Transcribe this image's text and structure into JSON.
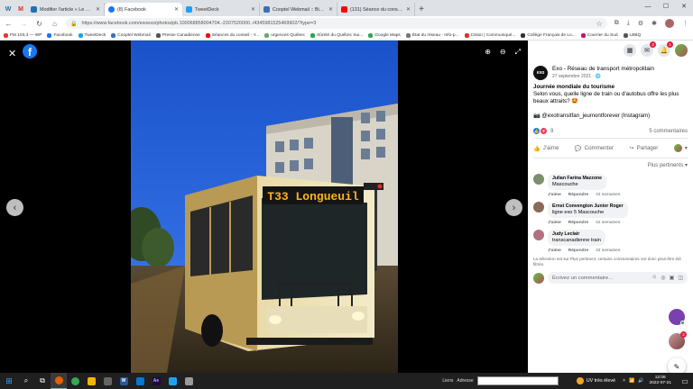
{
  "browser": {
    "pinned": [
      {
        "label": "W"
      },
      {
        "label": "M"
      }
    ],
    "tabs": [
      {
        "title": "Modifier l'article « Le manque d...",
        "color": "#2271b1",
        "active": false
      },
      {
        "title": "(8) Facebook",
        "color": "#1877f2",
        "active": true
      },
      {
        "title": "TweetDeck",
        "color": "#1da1f2",
        "active": false
      },
      {
        "title": "Cooptel Webmail :: Bienvenue...",
        "color": "#3b6fb6",
        "active": false
      },
      {
        "title": "(131) Séance du conseil munici...",
        "color": "#ff0000",
        "active": false
      }
    ],
    "url": "https://www.facebook.com/exoexo/photos/pb.100068858004704.-2207520000../4345981525469902/?type=3",
    "bookmarks": [
      {
        "label": "FM 103,3 — WP",
        "color": "#e53935"
      },
      {
        "label": "Facebook",
        "color": "#1877f2"
      },
      {
        "label": "TweetDeck",
        "color": "#1da1f2"
      },
      {
        "label": "Cooptel Webmail",
        "color": "#3b6fb6"
      },
      {
        "label": "Presse Canadienne",
        "color": "#555"
      },
      {
        "label": "Séances du conseil - Y...",
        "color": "#ff0000"
      },
      {
        "label": "urgences Québec",
        "color": "#6a6"
      },
      {
        "label": "Sûreté du Québec Sui...",
        "color": "#2a5"
      },
      {
        "label": "Google Maps",
        "color": "#34a853"
      },
      {
        "label": "État du réseau - Info-p...",
        "color": "#777"
      },
      {
        "label": "Cision | Communiqué...",
        "color": "#d32"
      },
      {
        "label": "Collège Français de Lo...",
        "color": "#333"
      },
      {
        "label": "Courrier du Sud",
        "color": "#c2185b"
      },
      {
        "label": "LBBQ",
        "color": "#555"
      }
    ]
  },
  "photo": {
    "destination_sign": "T33 Longueuil"
  },
  "panel": {
    "notif_badges": [
      "3",
      "1"
    ],
    "author": "Exo - Réseau de transport métropolitain",
    "date": "27 septembre 2021 · ",
    "post_title": "Journée mondiale du tourisme",
    "post_body": "Selon vous, quelle ligne de train ou d'autobus offre les plus beaux attraits? 🤩",
    "post_credit": "📷 @exotransitfan_jeumontforever (Instagram)",
    "reactions_count": "9",
    "comments_count": "5 commentaires",
    "like_label": "J'aime",
    "comment_label": "Commenter",
    "share_label": "Partager",
    "relevance_label": "Plus pertinents ▾",
    "comments": [
      {
        "name": "Julian Farina Mazzone",
        "text": "Mascouche",
        "like": "J'aime",
        "reply": "Répondre",
        "age": "42 semaines",
        "avatar": "#7a8f6a"
      },
      {
        "name": "Ernst Convengton Junior Roger",
        "text": "ligne exo 5 Mascouche",
        "like": "J'aime",
        "reply": "Répondre",
        "age": "42 semaines",
        "avatar": "#8a6a5a"
      },
      {
        "name": "Judy Leclair",
        "text": "transcanadienne train",
        "like": "J'aime",
        "reply": "Répondre",
        "age": "42 semaines",
        "avatar": "#b07080"
      }
    ],
    "notice": "La sélection est sur Plus pertinent, certains commentaires ont donc peut-être été filtrés.",
    "write_placeholder": "Écrivez un commentaire…",
    "float_badge": "2"
  },
  "taskbar": {
    "links_label": "Liens",
    "address_label": "Adresse",
    "weather": "UV très élevé",
    "time": "12:06",
    "date": "2022-07-21"
  }
}
